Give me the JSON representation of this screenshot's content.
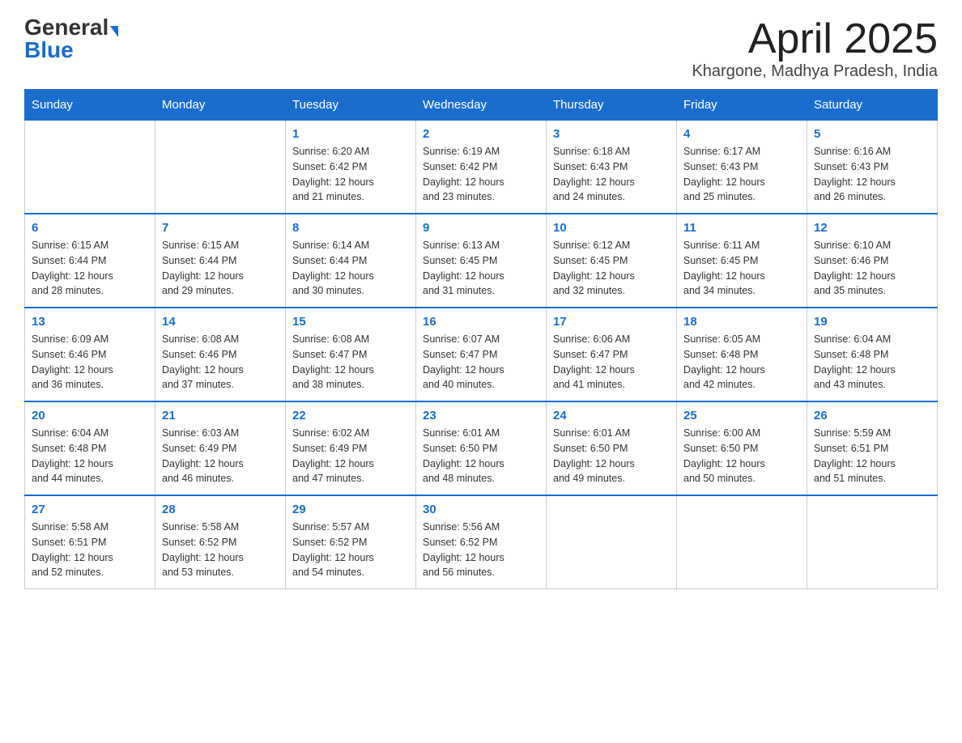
{
  "header": {
    "logo_general": "General",
    "logo_blue": "Blue",
    "month_year": "April 2025",
    "location": "Khargone, Madhya Pradesh, India"
  },
  "weekdays": [
    "Sunday",
    "Monday",
    "Tuesday",
    "Wednesday",
    "Thursday",
    "Friday",
    "Saturday"
  ],
  "weeks": [
    [
      {
        "day": "",
        "info": ""
      },
      {
        "day": "",
        "info": ""
      },
      {
        "day": "1",
        "info": "Sunrise: 6:20 AM\nSunset: 6:42 PM\nDaylight: 12 hours\nand 21 minutes."
      },
      {
        "day": "2",
        "info": "Sunrise: 6:19 AM\nSunset: 6:42 PM\nDaylight: 12 hours\nand 23 minutes."
      },
      {
        "day": "3",
        "info": "Sunrise: 6:18 AM\nSunset: 6:43 PM\nDaylight: 12 hours\nand 24 minutes."
      },
      {
        "day": "4",
        "info": "Sunrise: 6:17 AM\nSunset: 6:43 PM\nDaylight: 12 hours\nand 25 minutes."
      },
      {
        "day": "5",
        "info": "Sunrise: 6:16 AM\nSunset: 6:43 PM\nDaylight: 12 hours\nand 26 minutes."
      }
    ],
    [
      {
        "day": "6",
        "info": "Sunrise: 6:15 AM\nSunset: 6:44 PM\nDaylight: 12 hours\nand 28 minutes."
      },
      {
        "day": "7",
        "info": "Sunrise: 6:15 AM\nSunset: 6:44 PM\nDaylight: 12 hours\nand 29 minutes."
      },
      {
        "day": "8",
        "info": "Sunrise: 6:14 AM\nSunset: 6:44 PM\nDaylight: 12 hours\nand 30 minutes."
      },
      {
        "day": "9",
        "info": "Sunrise: 6:13 AM\nSunset: 6:45 PM\nDaylight: 12 hours\nand 31 minutes."
      },
      {
        "day": "10",
        "info": "Sunrise: 6:12 AM\nSunset: 6:45 PM\nDaylight: 12 hours\nand 32 minutes."
      },
      {
        "day": "11",
        "info": "Sunrise: 6:11 AM\nSunset: 6:45 PM\nDaylight: 12 hours\nand 34 minutes."
      },
      {
        "day": "12",
        "info": "Sunrise: 6:10 AM\nSunset: 6:46 PM\nDaylight: 12 hours\nand 35 minutes."
      }
    ],
    [
      {
        "day": "13",
        "info": "Sunrise: 6:09 AM\nSunset: 6:46 PM\nDaylight: 12 hours\nand 36 minutes."
      },
      {
        "day": "14",
        "info": "Sunrise: 6:08 AM\nSunset: 6:46 PM\nDaylight: 12 hours\nand 37 minutes."
      },
      {
        "day": "15",
        "info": "Sunrise: 6:08 AM\nSunset: 6:47 PM\nDaylight: 12 hours\nand 38 minutes."
      },
      {
        "day": "16",
        "info": "Sunrise: 6:07 AM\nSunset: 6:47 PM\nDaylight: 12 hours\nand 40 minutes."
      },
      {
        "day": "17",
        "info": "Sunrise: 6:06 AM\nSunset: 6:47 PM\nDaylight: 12 hours\nand 41 minutes."
      },
      {
        "day": "18",
        "info": "Sunrise: 6:05 AM\nSunset: 6:48 PM\nDaylight: 12 hours\nand 42 minutes."
      },
      {
        "day": "19",
        "info": "Sunrise: 6:04 AM\nSunset: 6:48 PM\nDaylight: 12 hours\nand 43 minutes."
      }
    ],
    [
      {
        "day": "20",
        "info": "Sunrise: 6:04 AM\nSunset: 6:48 PM\nDaylight: 12 hours\nand 44 minutes."
      },
      {
        "day": "21",
        "info": "Sunrise: 6:03 AM\nSunset: 6:49 PM\nDaylight: 12 hours\nand 46 minutes."
      },
      {
        "day": "22",
        "info": "Sunrise: 6:02 AM\nSunset: 6:49 PM\nDaylight: 12 hours\nand 47 minutes."
      },
      {
        "day": "23",
        "info": "Sunrise: 6:01 AM\nSunset: 6:50 PM\nDaylight: 12 hours\nand 48 minutes."
      },
      {
        "day": "24",
        "info": "Sunrise: 6:01 AM\nSunset: 6:50 PM\nDaylight: 12 hours\nand 49 minutes."
      },
      {
        "day": "25",
        "info": "Sunrise: 6:00 AM\nSunset: 6:50 PM\nDaylight: 12 hours\nand 50 minutes."
      },
      {
        "day": "26",
        "info": "Sunrise: 5:59 AM\nSunset: 6:51 PM\nDaylight: 12 hours\nand 51 minutes."
      }
    ],
    [
      {
        "day": "27",
        "info": "Sunrise: 5:58 AM\nSunset: 6:51 PM\nDaylight: 12 hours\nand 52 minutes."
      },
      {
        "day": "28",
        "info": "Sunrise: 5:58 AM\nSunset: 6:52 PM\nDaylight: 12 hours\nand 53 minutes."
      },
      {
        "day": "29",
        "info": "Sunrise: 5:57 AM\nSunset: 6:52 PM\nDaylight: 12 hours\nand 54 minutes."
      },
      {
        "day": "30",
        "info": "Sunrise: 5:56 AM\nSunset: 6:52 PM\nDaylight: 12 hours\nand 56 minutes."
      },
      {
        "day": "",
        "info": ""
      },
      {
        "day": "",
        "info": ""
      },
      {
        "day": "",
        "info": ""
      }
    ]
  ]
}
